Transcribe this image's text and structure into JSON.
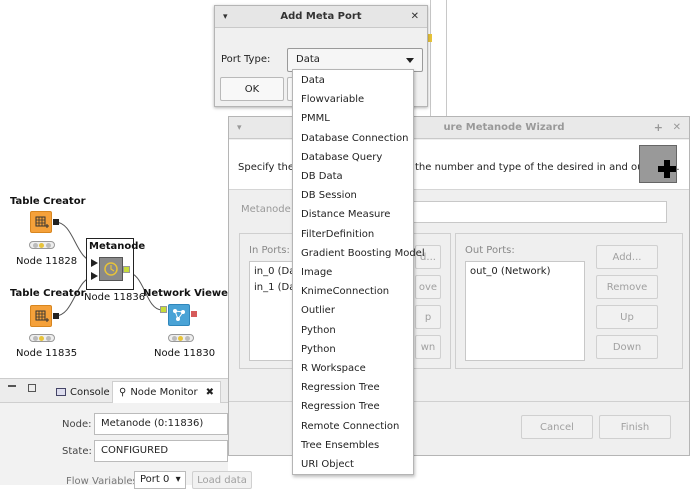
{
  "workflow": {
    "nodes": [
      {
        "title": "Table Creator",
        "label": "Node 11828"
      },
      {
        "title": "Table Creator",
        "label": "Node 11835"
      },
      {
        "title": "Metanode",
        "label": "Node 11836"
      },
      {
        "title": "Network Viewer",
        "label": "Node 11830"
      }
    ]
  },
  "bottom_panel": {
    "tabs": [
      {
        "label": "Console"
      },
      {
        "label": "Node Monitor"
      }
    ],
    "node_label": "Node:",
    "node_value": "Metanode  (0:11836)",
    "state_label": "State:",
    "state_value": "CONFIGURED",
    "flow_label": "Flow Variables",
    "port_select": "Port 0",
    "load_button": "Load data"
  },
  "add_port_dialog": {
    "title": "Add Meta Port",
    "port_type_label": "Port Type:",
    "selected": "Data",
    "ok_label": "OK",
    "options": [
      "Data",
      "Flowvariable",
      "PMML",
      "Database Connection",
      "Database Query",
      "DB Data",
      "DB Session",
      "Distance Measure",
      "FilterDefinition",
      "Gradient Boosting Model",
      "Image",
      "KnimeConnection",
      "Outlier",
      "Python",
      "Python",
      "R Workspace",
      "Regression Tree",
      "Regression Tree",
      "Remote Connection",
      "Tree Ensembles",
      "URI Object"
    ]
  },
  "wizard": {
    "title_visible": "ure Metanode Wizard",
    "description_left": "Specify the n",
    "description_right": "the number and type of the desired in and out ports.",
    "name_label": "Metanode N",
    "in_ports_label": "In Ports:",
    "in_ports": [
      "in_0 (Data",
      "in_1 (Data"
    ],
    "in_buttons_partial": [
      "d...",
      "ove",
      "p",
      "wn"
    ],
    "out_ports_label": "Out Ports:",
    "out_ports": [
      "out_0 (Network)"
    ],
    "out_buttons": [
      "Add...",
      "Remove",
      "Up",
      "Down"
    ],
    "cancel_label": "Cancel",
    "finish_label": "Finish"
  },
  "colors": {
    "node_orange": "#f5a13a",
    "node_blue": "#4aa3d6",
    "port_yellow": "#c8dc3a"
  }
}
